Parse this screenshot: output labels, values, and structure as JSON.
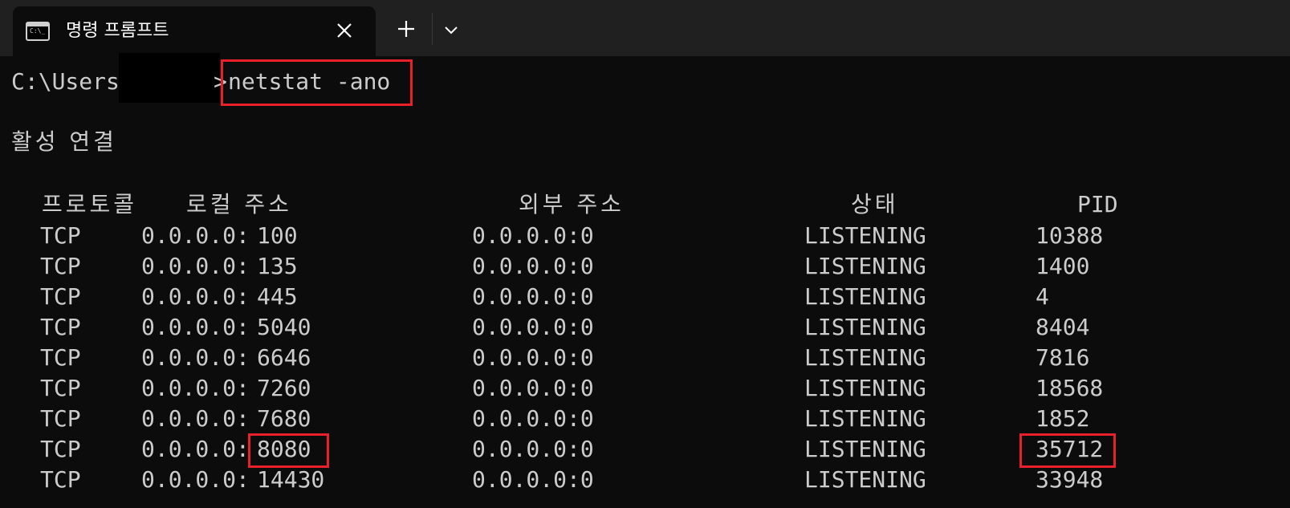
{
  "window": {
    "tab_title": "명령 프롬프트",
    "tab_icon_label": "C:\\_"
  },
  "terminal": {
    "prompt_prefix": "C:\\Users",
    "prompt_suffix": ">",
    "command": "netstat -ano",
    "section_title": "활성 연결",
    "columns": {
      "proto": "프로토콜",
      "local": "로컬 주소",
      "foreign": "외부 주소",
      "state": "상태",
      "pid": "PID"
    },
    "rows": [
      {
        "proto": "TCP",
        "local_ip": "0.0.0.0:",
        "local_port": "100",
        "foreign": "0.0.0.0:0",
        "state": "LISTENING",
        "pid": "10388"
      },
      {
        "proto": "TCP",
        "local_ip": "0.0.0.0:",
        "local_port": "135",
        "foreign": "0.0.0.0:0",
        "state": "LISTENING",
        "pid": "1400"
      },
      {
        "proto": "TCP",
        "local_ip": "0.0.0.0:",
        "local_port": "445",
        "foreign": "0.0.0.0:0",
        "state": "LISTENING",
        "pid": "4"
      },
      {
        "proto": "TCP",
        "local_ip": "0.0.0.0:",
        "local_port": "5040",
        "foreign": "0.0.0.0:0",
        "state": "LISTENING",
        "pid": "8404"
      },
      {
        "proto": "TCP",
        "local_ip": "0.0.0.0:",
        "local_port": "6646",
        "foreign": "0.0.0.0:0",
        "state": "LISTENING",
        "pid": "7816"
      },
      {
        "proto": "TCP",
        "local_ip": "0.0.0.0:",
        "local_port": "7260",
        "foreign": "0.0.0.0:0",
        "state": "LISTENING",
        "pid": "18568"
      },
      {
        "proto": "TCP",
        "local_ip": "0.0.0.0:",
        "local_port": "7680",
        "foreign": "0.0.0.0:0",
        "state": "LISTENING",
        "pid": "1852"
      },
      {
        "proto": "TCP",
        "local_ip": "0.0.0.0:",
        "local_port": "8080",
        "foreign": "0.0.0.0:0",
        "state": "LISTENING",
        "pid": "35712"
      },
      {
        "proto": "TCP",
        "local_ip": "0.0.0.0:",
        "local_port": "14430",
        "foreign": "0.0.0.0:0",
        "state": "LISTENING",
        "pid": "33948"
      }
    ]
  },
  "colors": {
    "terminal_bg": "#0c0c0c",
    "titlebar_bg": "#202020",
    "text": "#cccccc",
    "highlight": "#e8202a"
  }
}
